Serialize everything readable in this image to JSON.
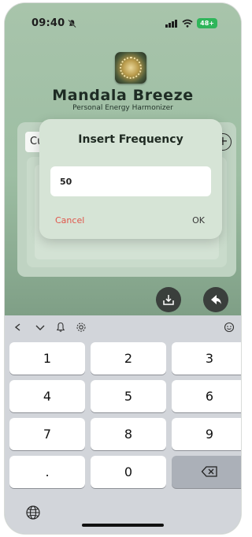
{
  "status_bar": {
    "time": "09:40",
    "battery": "48+"
  },
  "app": {
    "title": "Mandala Breeze",
    "subtitle": "Personal Energy Harmonizer"
  },
  "card": {
    "field_text": "Custom Freq"
  },
  "dialog": {
    "title": "Insert Frequency",
    "value": "50",
    "cancel_label": "Cancel",
    "ok_label": "OK"
  },
  "keyboard": {
    "keys": [
      "1",
      "2",
      "3",
      "4",
      "5",
      "6",
      "7",
      "8",
      "9",
      ".",
      "0"
    ]
  },
  "icons": {
    "bell": "bell-silent-icon",
    "download": "download-icon",
    "share": "share-icon",
    "globe": "globe-icon",
    "backspace": "backspace-icon"
  },
  "colors": {
    "cancel": "#e0564b",
    "accent_bg": "#a8c4ab"
  }
}
